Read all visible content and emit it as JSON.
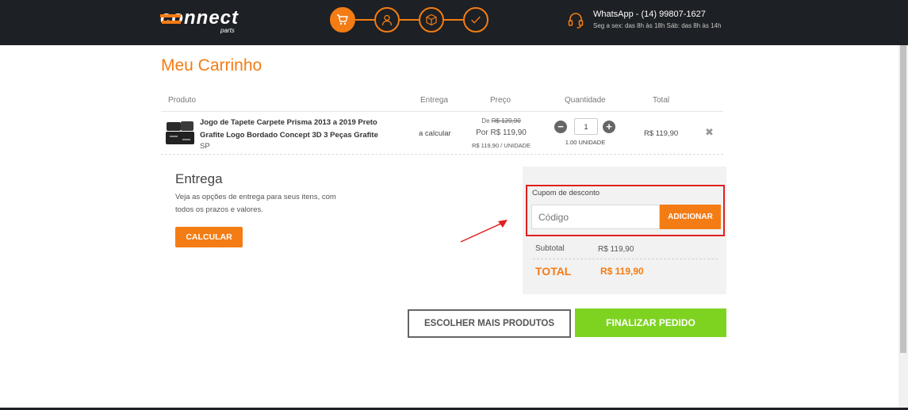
{
  "header": {
    "logo_text": "connect",
    "logo_subtext": "parts",
    "steps": [
      {
        "icon": "cart-icon",
        "active": true
      },
      {
        "icon": "user-icon",
        "active": false
      },
      {
        "icon": "box-icon",
        "active": false
      },
      {
        "icon": "check-icon",
        "active": false
      }
    ],
    "accent_color": "#f47c14",
    "contact_phone": "WhatsApp - (14) 99807-1627",
    "contact_hours": "Seg a sex: das 8h às 18h Sáb: das 8h às 14h"
  },
  "page": {
    "title": "Meu Carrinho"
  },
  "table": {
    "headers": {
      "product": "Produto",
      "delivery": "Entrega",
      "price": "Preço",
      "quantity": "Quantidade",
      "total": "Total"
    },
    "item": {
      "name": "Jogo de Tapete Carpete Prisma 2013 a 2019 Preto Grafite Logo Bordado Concept 3D 3 Peças Grafite",
      "state": "SP",
      "delivery": "a calcular",
      "price_old_prefix": "De",
      "price_old": "R$ 129,90",
      "price_now": "Por R$ 119,90",
      "price_unit": "R$ 119,90 / UNIDADE",
      "quantity": "1",
      "quantity_units": "1.00 UNIDADE",
      "decrement_symbol": "−",
      "increment_symbol": "+",
      "line_total": "R$ 119,90",
      "remove_symbol": "✖"
    }
  },
  "delivery_section": {
    "title": "Entrega",
    "description": "Veja as opções de entrega para seus itens, com todos os prazos e valores.",
    "calculate_button": "CALCULAR"
  },
  "summary": {
    "coupon_label": "Cupom de desconto",
    "coupon_placeholder": "Código",
    "coupon_button": "ADICIONAR",
    "subtotal_label": "Subtotal",
    "subtotal_value": "R$ 119,90",
    "total_label": "TOTAL",
    "total_value": "R$ 119,90",
    "highlight_color": "#e02020"
  },
  "actions": {
    "more_products": "ESCOLHER MAIS PRODUTOS",
    "finish_order": "FINALIZAR PEDIDO",
    "finish_color": "#7ed321"
  }
}
